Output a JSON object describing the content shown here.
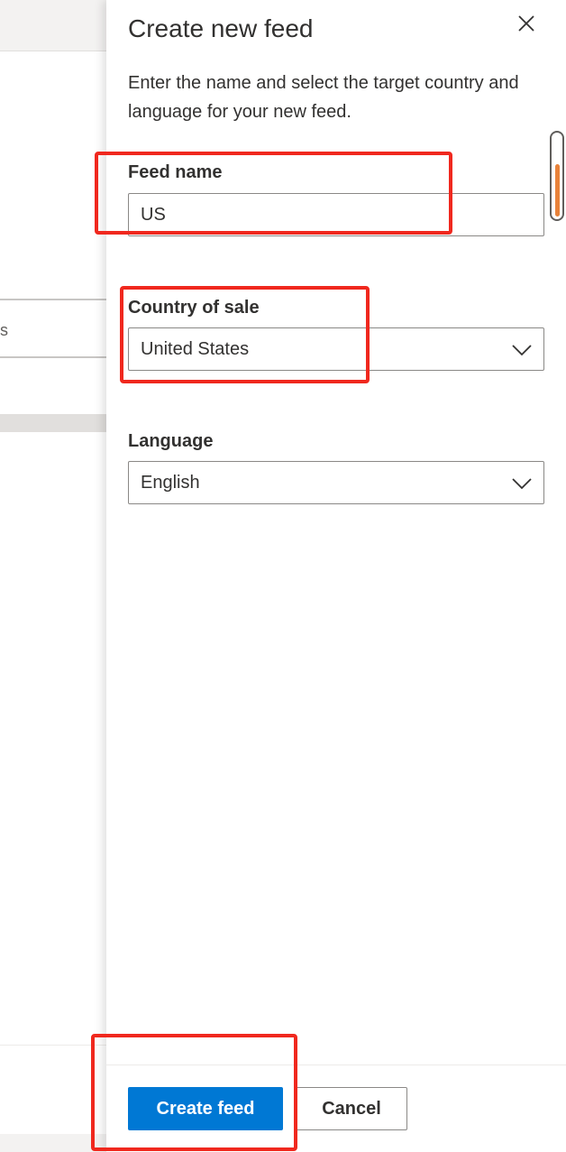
{
  "background": {
    "partial_field_text": "s"
  },
  "panel": {
    "title": "Create new feed",
    "description": "Enter the name and select the target country and language for your new feed.",
    "close_icon": "close-icon",
    "feed_name": {
      "label": "Feed name",
      "value": "US"
    },
    "country": {
      "label": "Country of sale",
      "value": "United States"
    },
    "language": {
      "label": "Language",
      "value": "English"
    },
    "footer": {
      "create_label": "Create feed",
      "cancel_label": "Cancel"
    }
  },
  "colors": {
    "primary": "#0078d4",
    "highlight": "#f0281e",
    "scroll_thumb": "#e8823a"
  }
}
